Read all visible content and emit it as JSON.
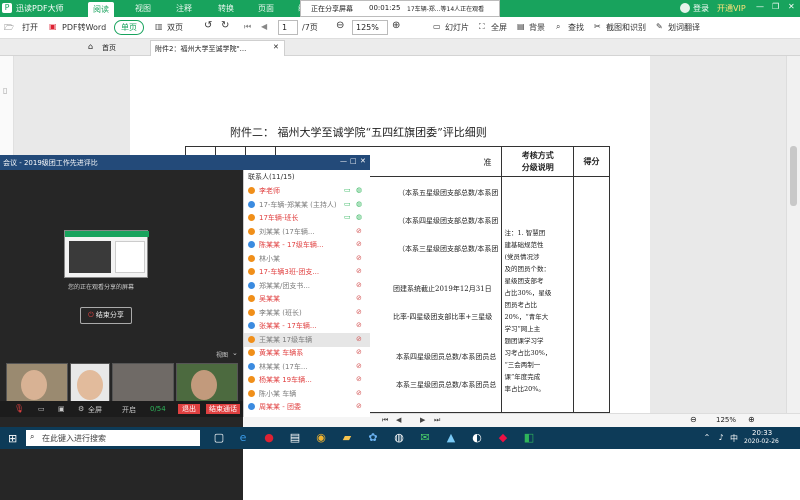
{
  "app": {
    "title": "迅读PDF大师",
    "tabs": [
      "阅读",
      "视图",
      "注释",
      "转换",
      "页面",
      "编辑"
    ],
    "active_tab": "阅读"
  },
  "share_bar": {
    "status": "正在分享屏幕",
    "timer": "00:01:25",
    "info": "17车辆-郑...等14人正在观看"
  },
  "user": {
    "login": "登录",
    "vip": "开通VIP"
  },
  "toolbar": {
    "open": "打开",
    "pdf_to_word": "PDF转Word",
    "single_page": "单页",
    "double_page": "双页",
    "page_current": "1",
    "page_total": "/7页",
    "zoom": "125%",
    "slideshow": "幻灯片",
    "fullscreen": "全屏",
    "background": "背景",
    "find": "查找",
    "screenshot": "截图和识别",
    "translate": "划词翻译"
  },
  "doc_tabs": {
    "home": "首页",
    "doc": "附件2：福州大学至诚学院\"..."
  },
  "document": {
    "heading": "附件二：  福州大学至诚学院“五四红旗团委”评比细则",
    "col_assess": "考核方式",
    "col_assess_sub": "分级说明",
    "col_score": "得分",
    "col_partial": "准",
    "rows": [
      "（本系五星级团支部总数/本系团",
      "（本系四星级团支部总数/本系团",
      "（本系三星级团支部总数/本系团",
      "团建系统截止2019年12月31日",
      "比率-四星级团支部比率+三星级",
      "本系四星级团员总数/本系团员总",
      "本系三星级团员总数/本系团员总"
    ],
    "notes": [
      "注：1. 智慧团",
      "建基础规范性",
      "(党员情况涉",
      "及的团员个数：",
      "星级团支部考",
      "占比30%，星级",
      "团员考占比",
      "20%，“青年大",
      "学习”网上主",
      "题团课学习学",
      "习考占比30%，",
      "“三会两制一",
      "课”年度完成",
      "率占比20%。"
    ]
  },
  "meeting": {
    "title": "会议 - 2019级团工作先进评比",
    "stage_caption": "您的正在观看分享的屏幕",
    "end_share": "结束分享",
    "view_label": "视图",
    "mute_label": "静音",
    "footer": {
      "fullscreen": "全屏",
      "camera": "开启",
      "speed": "0/54",
      "leave": "退出",
      "end": "结束通话"
    },
    "roster_title": "联系人(11/15)",
    "participants": [
      {
        "name": "李老师",
        "state": "on"
      },
      {
        "name": "17-车辆-郑某某 (主持人)",
        "state": "on"
      },
      {
        "name": "17车辆-班长",
        "state": "on"
      },
      {
        "name": "刘某某 (17车辆...",
        "state": "off"
      },
      {
        "name": "陈某某 - 17级车辆...",
        "state": "off"
      },
      {
        "name": "林小某",
        "state": "off"
      },
      {
        "name": "17-车辆3班-团支...",
        "state": "off"
      },
      {
        "name": "郑某某/团支书...",
        "state": "off"
      },
      {
        "name": "吴某某",
        "state": "off"
      },
      {
        "name": "李某某 (班长)",
        "state": "off"
      },
      {
        "name": "张某某 - 17车辆...",
        "state": "off"
      },
      {
        "name": "王某某 17级车辆",
        "state": "off"
      },
      {
        "name": "黄某某 车辆系",
        "state": "off"
      },
      {
        "name": "林某某 (17车...",
        "state": "off"
      },
      {
        "name": "杨某某 19车辆...",
        "state": "off"
      },
      {
        "name": "陈小某 车辆",
        "state": "off"
      },
      {
        "name": "周某某 - 团委",
        "state": "off"
      }
    ]
  },
  "bottom": {
    "zoom": "125%"
  },
  "taskbar": {
    "search": "在此键入进行搜索",
    "time": "20:33",
    "date": "2020-02-26",
    "ime": "中"
  },
  "colors": {
    "app_green": "#18a35d",
    "meeting_title": "#234a79",
    "taskbar": "#0d3b58",
    "red": "#e04040",
    "mic_on": "#2fb45a"
  }
}
